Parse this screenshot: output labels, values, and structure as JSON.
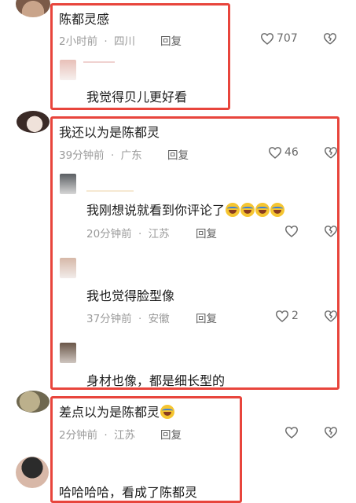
{
  "comments": [
    {
      "text": "陈都灵感",
      "time": "2小时前",
      "location": "四川",
      "reply_label": "回复",
      "likes": "707",
      "replies": [
        {
          "text": "我觉得贝儿更好看"
        }
      ]
    },
    {
      "text": "我还以为是陈都灵",
      "time": "39分钟前",
      "location": "广东",
      "reply_label": "回复",
      "likes": "46",
      "replies": [
        {
          "text": "我刚想说就看到你评论了",
          "time": "20分钟前",
          "location": "江苏",
          "reply_label": "回复"
        },
        {
          "text": "我也觉得脸型像",
          "time": "37分钟前",
          "location": "安徽",
          "reply_label": "回复",
          "likes": "2"
        },
        {
          "text": "身材也像，都是细长型的"
        }
      ]
    },
    {
      "text": "差点以为是陈都灵",
      "time": "2分钟前",
      "location": "江苏",
      "reply_label": "回复",
      "replies": [
        {
          "text": "哈哈哈哈，看成了陈都灵"
        }
      ]
    }
  ],
  "meta_separator": "·",
  "colors": {
    "highlight_box": "#e8453c",
    "meta_text": "#9a9a9a"
  },
  "icons": {
    "like": "heart-icon",
    "dislike": "broken-heart-icon",
    "emoji": "laughing-tears-emoji"
  }
}
